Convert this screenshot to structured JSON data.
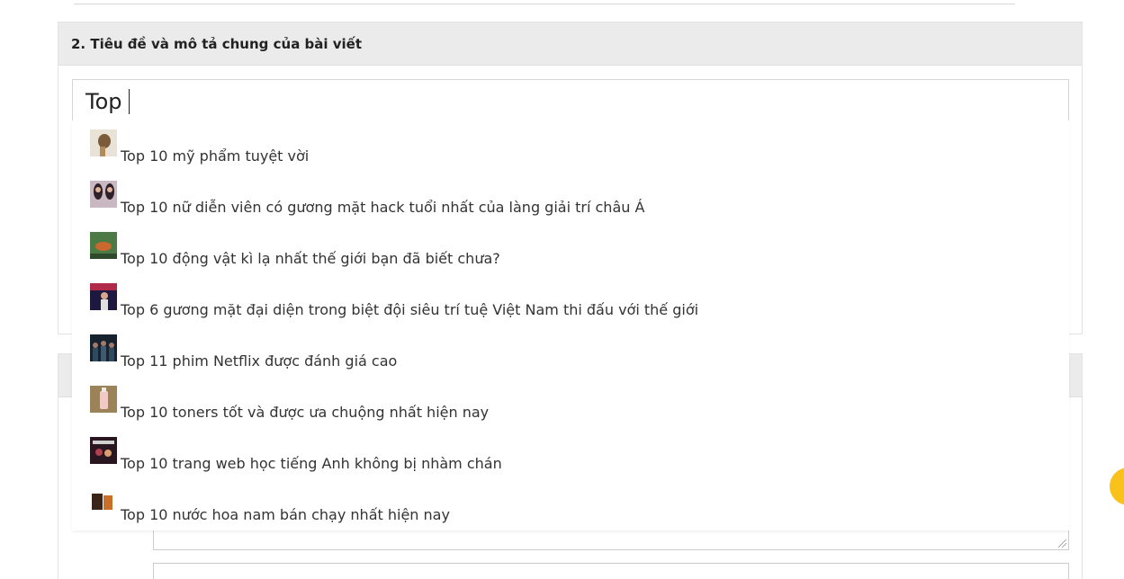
{
  "section": {
    "title": "2. Tiêu đề và mô tả chung của bài viết"
  },
  "title_input": {
    "value": "Top"
  },
  "suggestions": [
    {
      "label": "Top 10 mỹ phẩm tuyệt vời",
      "thumb_icon": "cosmetics-photo-thumbnail",
      "thumb_color": "#c7b59a"
    },
    {
      "label": "Top 10 nữ diễn viên có gương mặt hack tuổi nhất của làng giải trí châu Á",
      "thumb_icon": "actresses-photo-thumbnail",
      "thumb_color": "#7a5c70"
    },
    {
      "label": "Top 10 động vật kì lạ nhất thế giới bạn đã biết chưa?",
      "thumb_icon": "animal-photo-thumbnail",
      "thumb_color": "#3f6b3a"
    },
    {
      "label": "Top 6 gương mặt đại diện trong biệt đội siêu trí tuệ Việt Nam thi đấu với thế giới",
      "thumb_icon": "contestant-photo-thumbnail",
      "thumb_color": "#2a2450"
    },
    {
      "label": "Top 11 phim Netflix được đánh giá cao",
      "thumb_icon": "netflix-poster-thumbnail",
      "thumb_color": "#1f3040"
    },
    {
      "label": "Top 10 toners tốt và được ưa chuộng nhất hiện nay",
      "thumb_icon": "toner-bottle-thumbnail",
      "thumb_color": "#b89a6e"
    },
    {
      "label": "Top 10 trang web học tiếng Anh không bị nhàm chán",
      "thumb_icon": "english-website-thumbnail",
      "thumb_color": "#3a1e2a"
    },
    {
      "label": "Top 10 nước hoa nam bán chạy nhất hiện nay",
      "thumb_icon": "perfume-bottle-thumbnail",
      "thumb_color": "#5a3a2a"
    }
  ],
  "colors": {
    "header_bg": "#ebebeb",
    "accent": "#f8c21b"
  }
}
